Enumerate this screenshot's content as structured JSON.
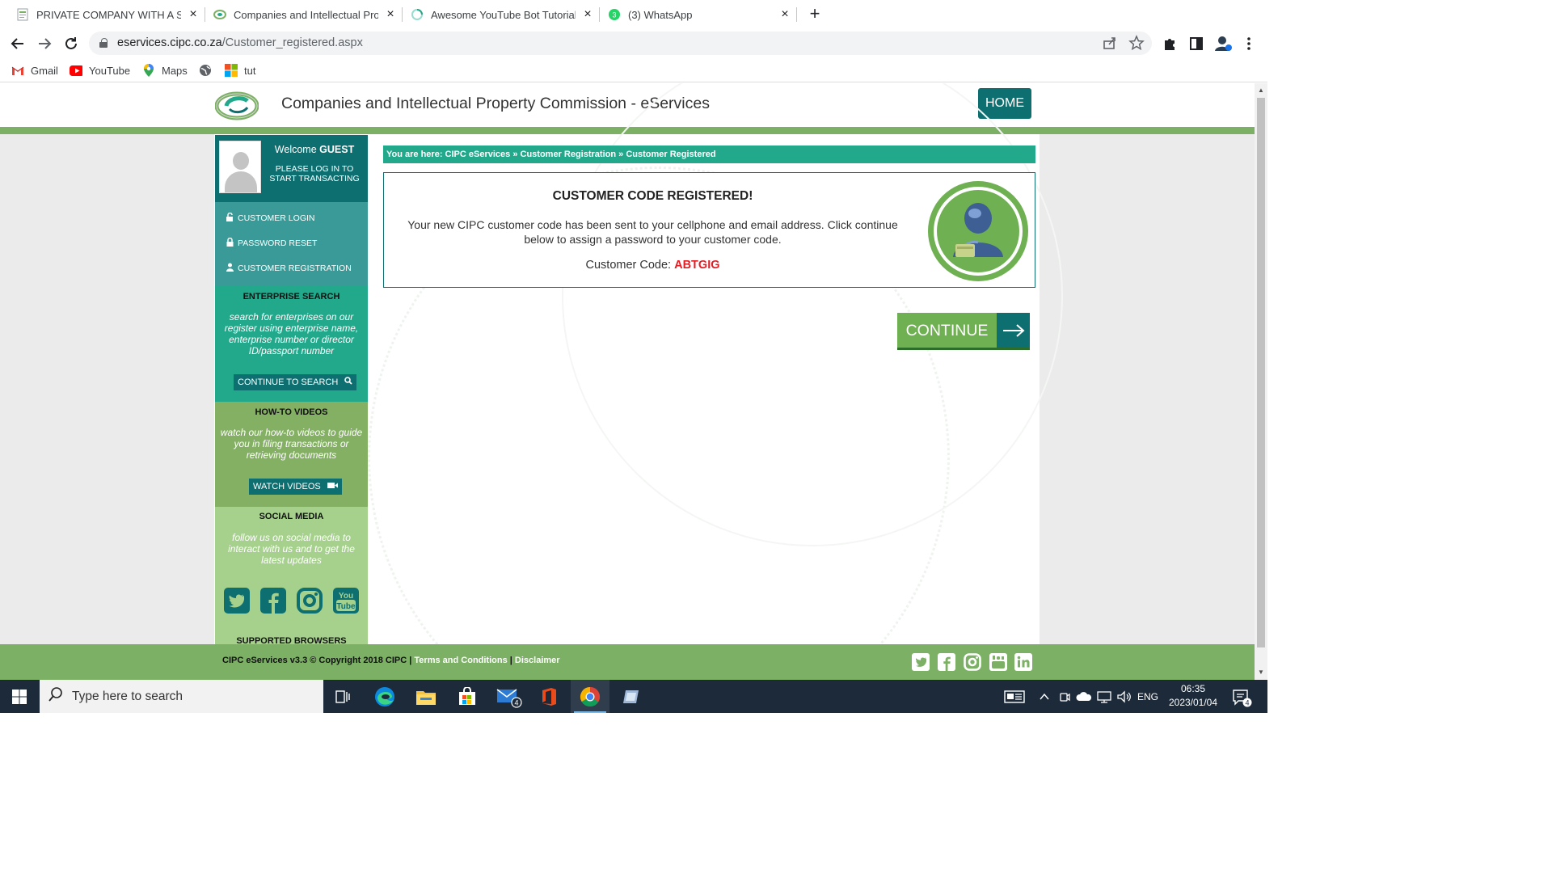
{
  "browser": {
    "tabs": [
      {
        "title": "PRIVATE COMPANY WITH A STANDARD",
        "close": "×"
      },
      {
        "title": "Companies and Intellectual Property",
        "close": "×"
      },
      {
        "title": "Awesome YouTube Bot Tutorial -",
        "close": "×"
      },
      {
        "title": "(3) WhatsApp",
        "close": "×",
        "badge": "3"
      }
    ],
    "new_tab": "+",
    "url_host": "eservices.cipc.co.za",
    "url_path": "/Customer_registered.aspx",
    "bookmarks": [
      "Gmail",
      "YouTube",
      "Maps",
      "tut"
    ]
  },
  "site": {
    "title": "Companies and Intellectual Property Commission - eServices",
    "home_label": "HOME"
  },
  "sidebar": {
    "welcome_prefix": "Welcome ",
    "welcome_user": "GUEST",
    "login_note": "PLEASE LOG IN TO START TRANSACTING",
    "links": [
      "CUSTOMER LOGIN",
      "PASSWORD RESET",
      "CUSTOMER REGISTRATION"
    ],
    "enterprise": {
      "heading": "ENTERPRISE SEARCH",
      "description": "search for enterprises on our register using enterprise name, enterprise number or director ID/passport number",
      "button": "CONTINUE TO SEARCH"
    },
    "videos": {
      "heading": "HOW-TO VIDEOS",
      "description": "watch our how-to videos to guide you in filing transactions or retrieving documents",
      "button": "WATCH VIDEOS"
    },
    "social": {
      "heading": "SOCIAL MEDIA",
      "description": "follow us on social media to interact with us and to get the latest updates",
      "youtube_text": "You Tube"
    },
    "browsers_heading": "SUPPORTED BROWSERS"
  },
  "breadcrumb": {
    "prefix": "You are here: ",
    "items": [
      "CIPC eServices",
      "Customer Registration",
      "Customer Registered"
    ],
    "sep": " » "
  },
  "panel": {
    "title": "CUSTOMER CODE REGISTERED!",
    "message": "Your new CIPC customer code has been sent to your cellphone and email address. Click continue below to assign a password to your customer code.",
    "code_label": "Customer Code: ",
    "code_value": "ABTGIG"
  },
  "continue_label": "CONTINUE",
  "footer": {
    "copyright": "CIPC eServices v3.3 © Copyright 2018 CIPC | ",
    "terms": "Terms and Conditions",
    "sep": " | ",
    "disclaimer": "Disclaimer"
  },
  "taskbar": {
    "search_placeholder": "Type here to search",
    "mail_badge": "4",
    "language": "ENG",
    "time": "06:35",
    "date": "2023/01/04",
    "notification_count": "4"
  },
  "colors": {
    "teal": "#0e6f70",
    "green": "#7cb065",
    "breadcrumb": "#22a98b",
    "code_red": "#e01f25"
  }
}
